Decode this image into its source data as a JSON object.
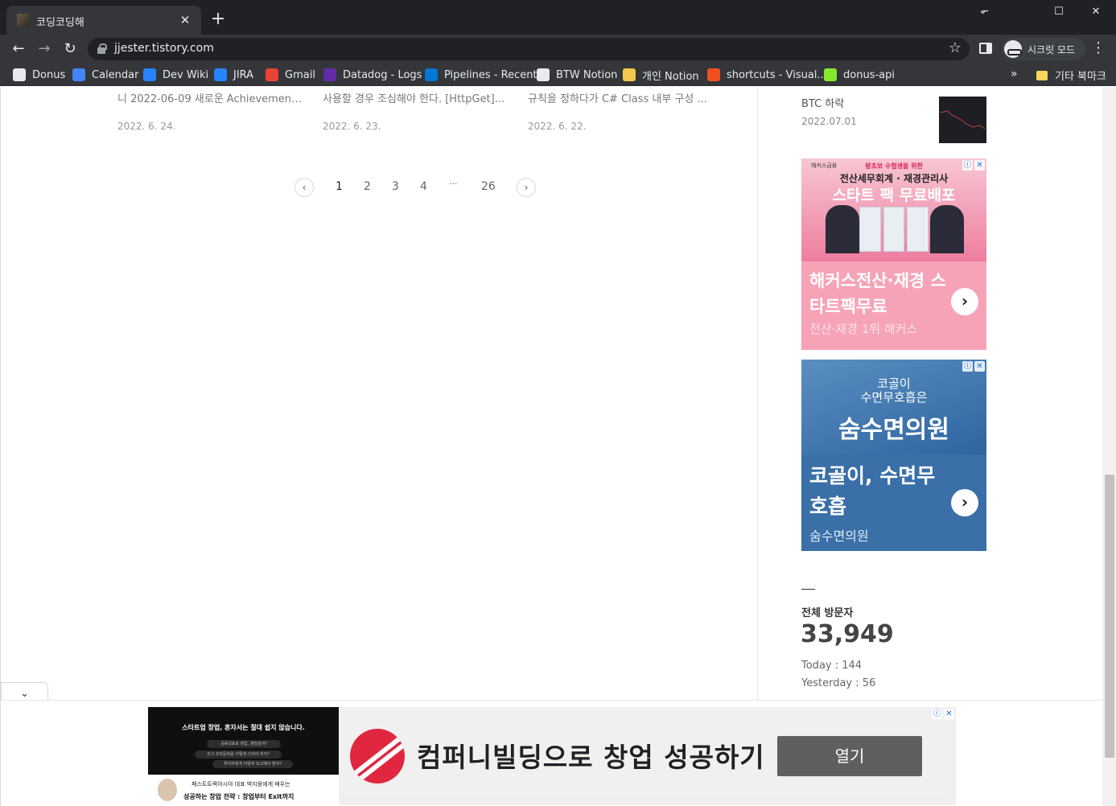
{
  "browser": {
    "tab_title": "코딩코딩해",
    "tab_close": "✕",
    "new_tab": "+",
    "window_controls": {
      "minimize": "─",
      "maximize": "☐",
      "close": "✕"
    },
    "url": "jjester.tistory.com",
    "incognito_label": "시크릿 모드",
    "bookmarks": [
      {
        "label": "Donus",
        "icon": "github-icon",
        "color": "#e8eaed"
      },
      {
        "label": "Calendar",
        "icon": "calendar-icon",
        "color": "#4285f4"
      },
      {
        "label": "Dev Wiki",
        "icon": "confluence-icon",
        "color": "#2684ff"
      },
      {
        "label": "JIRA",
        "icon": "jira-icon",
        "color": "#2684ff"
      },
      {
        "label": "Gmail",
        "icon": "gmail-icon",
        "color": "#ea4335"
      },
      {
        "label": "Datadog - Logs",
        "icon": "datadog-icon",
        "color": "#632ca6"
      },
      {
        "label": "Pipelines - Recent",
        "icon": "pipelines-icon",
        "color": "#0078d4"
      },
      {
        "label": "BTW Notion",
        "icon": "checkered-flag-icon",
        "color": "#e8eaed"
      },
      {
        "label": "개인 Notion",
        "icon": "badge-icon",
        "color": "#f2c94c"
      },
      {
        "label": "shortcuts - Visual...",
        "icon": "microsoft-icon",
        "color": "#f25022"
      },
      {
        "label": "donus-api",
        "icon": "swagger-icon",
        "color": "#85ea2d"
      }
    ],
    "bookmarks_more": "»",
    "other_bookmarks": "기타 북마크"
  },
  "posts": [
    {
      "excerpt": "니 2022-06-09 새로운 Achievement...",
      "date": "2022. 6. 24."
    },
    {
      "excerpt": "사용할 경우 조심해야 한다. [HttpGet]...",
      "date": "2022. 6. 23."
    },
    {
      "excerpt": "규칙을 정하다가 C# Class 내부 구성 ...",
      "date": "2022. 6. 22."
    }
  ],
  "pagination": {
    "prev": "‹",
    "next": "›",
    "pages": [
      "1",
      "2",
      "3",
      "4",
      "···",
      "26"
    ],
    "current": "1"
  },
  "sidebar": {
    "recent": {
      "title": "BTC 하락",
      "date": "2022.07.01"
    },
    "ad1": {
      "brand": "해커스금융",
      "line1": "왕초보 수험생을 위한",
      "line2": "전산세무회계 · 재경관리사",
      "line3": "스타트 팩 무료배포",
      "headline": "해커스전산·재경 스타트팩무료",
      "sub": "전산·재경 1위 해커스",
      "colors": {
        "accent": "#d6245b",
        "bg": "#f7a3b7"
      }
    },
    "ad2": {
      "line1": "코골이",
      "line1b": "수면무호흡은",
      "brand": "숨수면의원",
      "headline": "코골이, 수면무호흡",
      "sub": "숨수면의원",
      "colors": {
        "bg": "#3a6fa8"
      }
    },
    "ad_info_icon": "ⓘ",
    "ad_close_icon": "✕",
    "ad_arrow": "›",
    "visitors": {
      "label": "전체 방문자",
      "total": "33,949",
      "today": "Today : 144",
      "yesterday": "Yesterday : 56"
    }
  },
  "anchor_ad": {
    "collapse": "⌄",
    "left_headline": "스타트업 창업, 혼자서는 절대 쉽지 않습니다.",
    "left_pills": [
      "공동대표로 창업, 괜찮을까?",
      "초기 조직문화를 어떻게 다져야 하지?",
      "투자자에게 어떻게 보고해야 할까?"
    ],
    "left_line1": "패스트트랙아시아 대표 박지웅에게 배우는",
    "left_line2": "성공하는 창업 전략 : 창업부터 Exit까지",
    "headline": "컴퍼니빌딩으로 창업 성공하기",
    "button": "열기",
    "colors": {
      "logo": "#e0273f",
      "button": "#5f5f5f"
    }
  }
}
